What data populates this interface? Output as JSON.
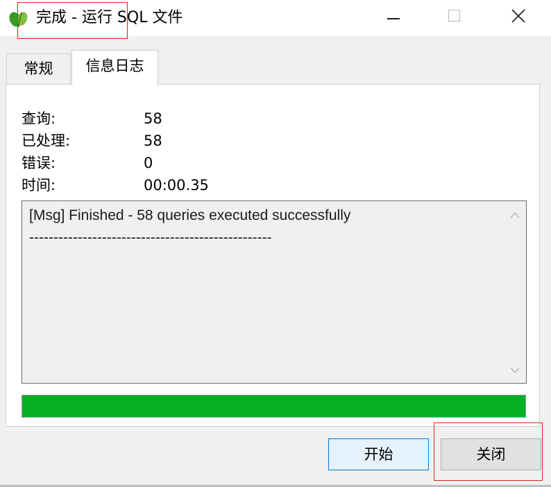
{
  "window": {
    "title": "完成 - 运行 SQL 文件",
    "app_icon": "navicat-leaf-icon",
    "controls": [
      "minimize-icon",
      "maximize-icon",
      "close-icon"
    ]
  },
  "tabs": [
    {
      "label": "常规",
      "active": false
    },
    {
      "label": "信息日志",
      "active": true
    }
  ],
  "stats": [
    {
      "label": "查询:",
      "value": "58"
    },
    {
      "label": "已处理:",
      "value": "58"
    },
    {
      "label": "错误:",
      "value": "0"
    },
    {
      "label": "时间:",
      "value": "00:00.35"
    }
  ],
  "log": {
    "lines": [
      "[Msg] Finished - 58 queries executed successfully",
      "--------------------------------------------------"
    ]
  },
  "progress": {
    "fraction": 1.0,
    "color": "#06b025"
  },
  "buttons": {
    "start_label": "开始",
    "close_label": "关闭"
  },
  "highlight_color": "#d9261c"
}
